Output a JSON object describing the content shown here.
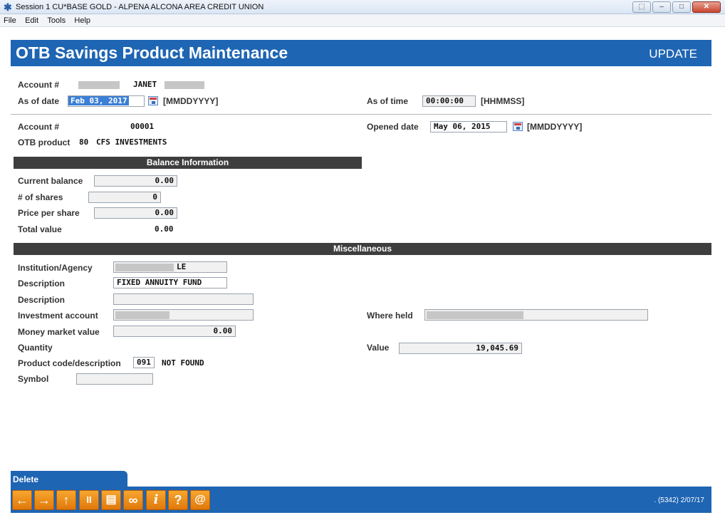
{
  "window": {
    "title": "Session 1 CU*BASE GOLD - ALPENA ALCONA AREA CREDIT UNION",
    "buttons": [
      "⬚",
      "–",
      "□",
      "✕"
    ]
  },
  "menu": [
    "File",
    "Edit",
    "Tools",
    "Help"
  ],
  "header": {
    "title": "OTB Savings Product Maintenance",
    "mode": "UPDATE"
  },
  "top": {
    "account_label": "Account #",
    "member_name": "JANET",
    "as_of_date_label": "As of date",
    "as_of_date_value": "Feb 03, 2017",
    "as_of_date_format": "[MMDDYYYY]",
    "as_of_time_label": "As of time",
    "as_of_time_value": "00:00:00",
    "as_of_time_format": "[HHMMSS]"
  },
  "product": {
    "account_label": "Account #",
    "account_value": "00001",
    "otb_product_label": "OTB product",
    "otb_product_code": "80",
    "otb_product_name": "CFS INVESTMENTS",
    "opened_date_label": "Opened date",
    "opened_date_value": "May 06, 2015",
    "opened_date_format": "[MMDDYYYY]"
  },
  "balance": {
    "section_title": "Balance Information",
    "current_balance_label": "Current balance",
    "current_balance_value": "0.00",
    "shares_label": "# of shares",
    "shares_value": "0",
    "price_label": "Price per share",
    "price_value": "0.00",
    "total_label": "Total value",
    "total_value": "0.00"
  },
  "misc": {
    "section_title": "Miscellaneous",
    "institution_label": "Institution/Agency",
    "institution_value": "LE",
    "description1_label": "Description",
    "description1_value": "FIXED ANNUITY FUND",
    "description2_label": "Description",
    "description2_value": "",
    "investment_label": "Investment account",
    "money_market_label": "Money market value",
    "money_market_value": "0.00",
    "quantity_label": "Quantity",
    "product_code_label": "Product code/description",
    "product_code_value": "091",
    "product_code_desc": "NOT FOUND",
    "symbol_label": "Symbol",
    "symbol_value": "",
    "where_held_label": "Where held",
    "value_label": "Value",
    "value_value": "19,045.69"
  },
  "footer": {
    "delete_label": "Delete",
    "version": ". (5342) 2/07/17",
    "toolbar": [
      {
        "name": "back-icon",
        "glyph": "←"
      },
      {
        "name": "forward-icon",
        "glyph": "→"
      },
      {
        "name": "up-icon",
        "glyph": "↑"
      },
      {
        "name": "pause-icon",
        "glyph": "II"
      },
      {
        "name": "print-icon",
        "glyph": "▤"
      },
      {
        "name": "link-icon",
        "glyph": "∞"
      },
      {
        "name": "info-icon",
        "glyph": "i"
      },
      {
        "name": "help-icon",
        "glyph": "?"
      },
      {
        "name": "email-icon",
        "glyph": "@"
      }
    ]
  }
}
